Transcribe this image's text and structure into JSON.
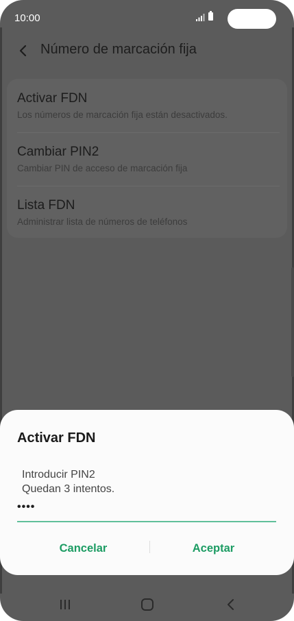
{
  "status_bar": {
    "time": "10:00",
    "icons": [
      "signal-icon",
      "battery-icon"
    ]
  },
  "header": {
    "back_icon": "back-arrow-icon",
    "title": "Número de marcación fija"
  },
  "settings": {
    "items": [
      {
        "title": "Activar FDN",
        "subtitle": "Los números de marcación fija están desactivados."
      },
      {
        "title": "Cambiar PIN2",
        "subtitle": "Cambiar PIN de acceso de marcación fija"
      },
      {
        "title": "Lista FDN",
        "subtitle": "Administrar lista de números de teléfonos"
      }
    ]
  },
  "dialog": {
    "title": "Activar FDN",
    "message_line1": "Introducir PIN2",
    "message_line2": "Quedan 3 intentos.",
    "pin_value": "••••",
    "cancel_label": "Cancelar",
    "accept_label": "Aceptar",
    "accent_color": "#1c9c63"
  },
  "nav_bar": {
    "icons": [
      "recent-apps-icon",
      "home-icon",
      "back-icon"
    ]
  }
}
